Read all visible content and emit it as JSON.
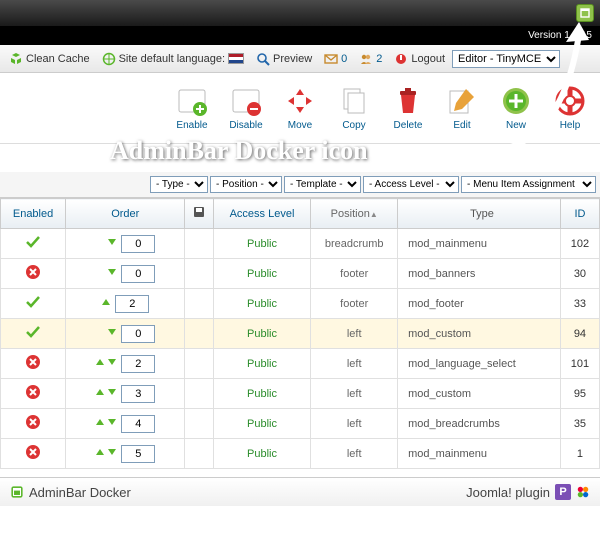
{
  "version_text": "Version 1.3.15",
  "menubar": {
    "clean_cache": "Clean Cache",
    "lang_label": "Site default language:",
    "preview": "Preview",
    "msg_count": "0",
    "user_count": "2",
    "logout": "Logout",
    "editor_select": "Editor - TinyMCE"
  },
  "toolbar": [
    {
      "id": "enable",
      "label": "Enable"
    },
    {
      "id": "disable",
      "label": "Disable"
    },
    {
      "id": "move",
      "label": "Move"
    },
    {
      "id": "copy",
      "label": "Copy"
    },
    {
      "id": "delete",
      "label": "Delete"
    },
    {
      "id": "edit",
      "label": "Edit"
    },
    {
      "id": "new",
      "label": "New"
    },
    {
      "id": "help",
      "label": "Help"
    }
  ],
  "callout_text": "AdminBar Docker icon",
  "filters": {
    "type": "- Type -",
    "position": "- Position -",
    "template": "- Template -",
    "access": "- Access Level -",
    "menu": "- Menu Item Assignment -"
  },
  "headers": {
    "enabled": "Enabled",
    "order": "Order",
    "access": "Access Level",
    "position": "Position",
    "type": "Type",
    "id": "ID"
  },
  "rows": [
    {
      "enabled": true,
      "up": false,
      "down": true,
      "order": "0",
      "access": "Public",
      "position": "breadcrumb",
      "type": "mod_mainmenu",
      "id": "102"
    },
    {
      "enabled": false,
      "up": false,
      "down": true,
      "order": "0",
      "access": "Public",
      "position": "footer",
      "type": "mod_banners",
      "id": "30"
    },
    {
      "enabled": true,
      "up": true,
      "down": false,
      "order": "2",
      "access": "Public",
      "position": "footer",
      "type": "mod_footer",
      "id": "33"
    },
    {
      "enabled": true,
      "up": false,
      "down": true,
      "order": "0",
      "access": "Public",
      "position": "left",
      "type": "mod_custom",
      "id": "94",
      "hl": true
    },
    {
      "enabled": false,
      "up": true,
      "down": true,
      "order": "2",
      "access": "Public",
      "position": "left",
      "type": "mod_language_select",
      "id": "101"
    },
    {
      "enabled": false,
      "up": true,
      "down": true,
      "order": "3",
      "access": "Public",
      "position": "left",
      "type": "mod_custom",
      "id": "95"
    },
    {
      "enabled": false,
      "up": true,
      "down": true,
      "order": "4",
      "access": "Public",
      "position": "left",
      "type": "mod_breadcrumbs",
      "id": "35"
    },
    {
      "enabled": false,
      "up": true,
      "down": true,
      "order": "5",
      "access": "Public",
      "position": "left",
      "type": "mod_mainmenu",
      "id": "1"
    }
  ],
  "footer": {
    "product": "AdminBar Docker",
    "plugin_label": "Joomla! plugin"
  }
}
